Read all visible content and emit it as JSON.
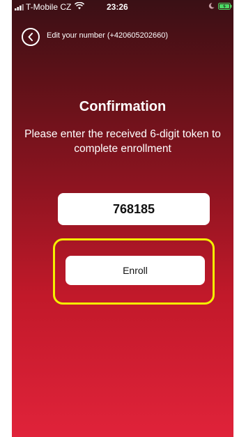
{
  "status_bar": {
    "carrier": "T-Mobile CZ",
    "time": "23:26",
    "icons": [
      "signal-icon",
      "wifi-icon",
      "moon-icon",
      "battery-icon"
    ]
  },
  "nav": {
    "back_icon": "chevron-left-icon",
    "title": "Edit your number (+420605202660)"
  },
  "main": {
    "title": "Confirmation",
    "instructions": "Please enter the received 6-digit token to complete enrollment",
    "token_value": "768185",
    "enroll_label": "Enroll"
  },
  "colors": {
    "gradient_top": "#3a1015",
    "gradient_bottom": "#e0233a",
    "highlight": "#f5f000",
    "battery": "#4cd964"
  }
}
